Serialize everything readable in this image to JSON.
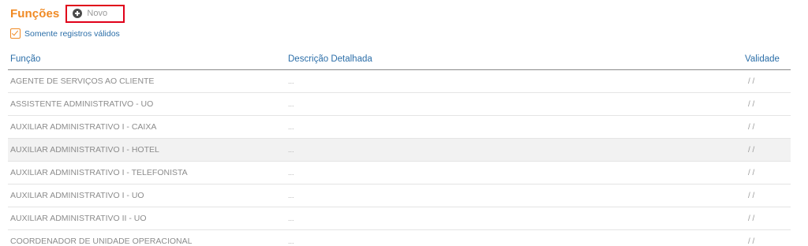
{
  "header": {
    "title": "Funções",
    "new_label": "Novo"
  },
  "filter": {
    "label": "Somente registros válidos",
    "checked": true
  },
  "table": {
    "columns": [
      "Função",
      "Descrição Detalhada",
      "Validade"
    ],
    "rows": [
      {
        "funcao": "AGENTE DE SERVIÇOS AO CLIENTE",
        "descricao": "...",
        "validade": "/ /"
      },
      {
        "funcao": "ASSISTENTE ADMINISTRATIVO - UO",
        "descricao": "...",
        "validade": "/ /"
      },
      {
        "funcao": "AUXILIAR ADMINISTRATIVO I - CAIXA",
        "descricao": "...",
        "validade": "/ /"
      },
      {
        "funcao": "AUXILIAR ADMINISTRATIVO I - HOTEL",
        "descricao": "...",
        "validade": "/ /"
      },
      {
        "funcao": "AUXILIAR ADMINISTRATIVO I - TELEFONISTA",
        "descricao": "...",
        "validade": "/ /"
      },
      {
        "funcao": "AUXILIAR ADMINISTRATIVO I - UO",
        "descricao": "...",
        "validade": "/ /"
      },
      {
        "funcao": "AUXILIAR ADMINISTRATIVO II - UO",
        "descricao": "...",
        "validade": "/ /"
      },
      {
        "funcao": "COORDENADOR DE UNIDADE OPERACIONAL",
        "descricao": "...",
        "validade": "/ /"
      }
    ]
  },
  "colors": {
    "accent": "#f08a24",
    "link": "#2b6ea8",
    "highlight_border": "#e0001a"
  }
}
